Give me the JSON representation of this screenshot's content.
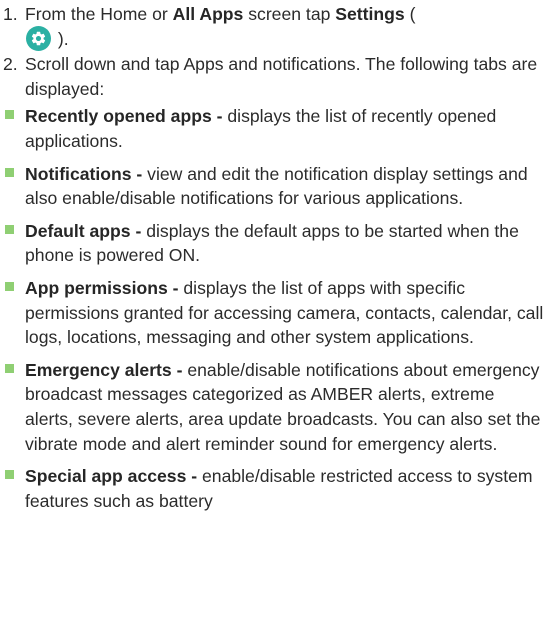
{
  "steps": [
    {
      "num": "1.",
      "pre": "From the Home or ",
      "b1": "All Apps",
      "mid": " screen tap ",
      "b2": "Settings",
      "open": " (",
      "close": " )."
    },
    {
      "num": "2.",
      "text": "Scroll down and tap Apps and notifications. The following tabs are displayed:"
    }
  ],
  "bullets": [
    {
      "title": "Recently opened apps -",
      "desc": " displays the list of recently opened applications."
    },
    {
      "title": "Notifications -",
      "desc": " view and edit the notification display settings and also enable/disable notifications for various applications."
    },
    {
      "title": "Default apps -",
      "desc": " displays the default apps to be started when the phone is powered ON."
    },
    {
      "title": "App permissions -",
      "desc": " displays the list of apps with specific permissions granted for accessing camera, contacts, calendar, call logs, locations, messaging and other system applications."
    },
    {
      "title": "Emergency alerts -",
      "desc": " enable/disable notifications about emergency broadcast messages categorized as AMBER alerts, extreme alerts, severe alerts, area update broadcasts. You can also set the vibrate mode and alert reminder sound for emergency alerts."
    },
    {
      "title": "Special app access -",
      "desc": " enable/disable restricted access to system features such as battery"
    }
  ],
  "colors": {
    "bullet": "#8fcf73",
    "settings_icon_bg": "#2bb0a3",
    "text": "#2b2b2b"
  },
  "icons": {
    "settings": "gear-icon"
  }
}
